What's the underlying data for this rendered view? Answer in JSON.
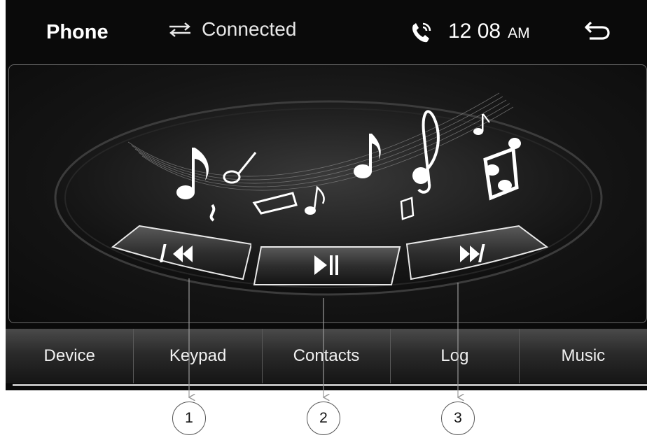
{
  "status_bar": {
    "title": "Phone",
    "connection_icon": "swap-arrows-icon",
    "connection_label": "Connected",
    "phone_icon": "phone-ringing-icon",
    "time": "12 08",
    "ampm": "AM",
    "back_icon": "back-arrow-icon"
  },
  "player": {
    "artwork_icon": "music-notes-icon",
    "controls": [
      {
        "name": "previous-track",
        "icon": "skip-previous-icon"
      },
      {
        "name": "play-pause",
        "icon": "play-pause-icon"
      },
      {
        "name": "next-track",
        "icon": "skip-next-icon"
      }
    ]
  },
  "tabs": [
    {
      "label": "Device"
    },
    {
      "label": "Keypad"
    },
    {
      "label": "Contacts"
    },
    {
      "label": "Log"
    },
    {
      "label": "Music"
    }
  ],
  "callouts": [
    "1",
    "2",
    "3"
  ]
}
